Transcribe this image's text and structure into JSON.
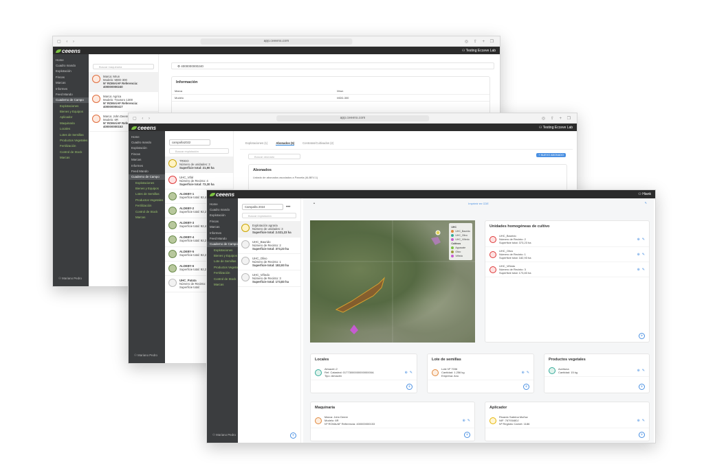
{
  "app": {
    "brand": "ceeens",
    "user1": "Testing Ecceve Lab",
    "user3": "Hiank"
  },
  "w1": {
    "url": "app.ceeens.com",
    "search_placeholder": "Buscar maquinaria",
    "sidebar": [
      "Home",
      "Cuadro mando",
      "Explotación",
      "Fincas",
      "Marcas",
      "Informes",
      "Feed Mando"
    ],
    "section": "Cuaderno de Campo",
    "subitems": [
      "Explotaciones",
      "Bienes y Equipos",
      "Aplicador",
      "Maquinaria",
      "Locales",
      "Lotes de Semillas",
      "Productos Vegetales",
      "Fertilización",
      "Control de Stock",
      "Marcas"
    ],
    "machine_ref": "4000000000240",
    "items": [
      {
        "l1": "Marca: Mrun",
        "l2": "Modelo: MDD-300",
        "l3": "Nº ROMA/AF Referencia: 400000000240"
      },
      {
        "l1": "Marca: Agrica",
        "l2": "Modelo: Tractoro 1300",
        "l3": "Nº ROMA/AF Referencia: 400000000417"
      },
      {
        "l1": "Marca: John Deere",
        "l2": "Modelo: 6R",
        "l3": "Nº ROMA/AF Referencia: 400000000153"
      }
    ],
    "info_title": "Información",
    "info_rows": [
      [
        "Marca",
        "Mrun"
      ],
      [
        "Modelo",
        "MDD-300"
      ]
    ],
    "user": "Mariano Pedro"
  },
  "w2": {
    "url": "app.ceeens.com",
    "campaign": "campaña2022",
    "search_placeholder": "Buscar explotación",
    "tabs": [
      "Explotaciones (1)",
      "Abonados (5)",
      "Contratos/Cultivados (2)"
    ],
    "new_btn": "+ NUEVO ABONADO",
    "search2": "Buscar abonado",
    "card_title": "Abonados",
    "card_sub": "Listado de abonados asociados a Parcela (ALBEV-1)",
    "cols": [
      "Nombre",
      "Inicio",
      "Final",
      "Acciones"
    ],
    "list": [
      {
        "t": "TRIGO",
        "a": "Número de unidades: 3",
        "b": "Superficie total: 21,90 ha"
      },
      {
        "t": "UHC_Vifal",
        "a": "Número de Recinto: 4",
        "b": "Superficie total: 73,30 ha"
      },
      {
        "t": "ALDEBY-1",
        "a": "Superficie total: 92,46",
        "b": ""
      },
      {
        "t": "ALDEBY-2",
        "a": "Superficie total: 92,27",
        "b": ""
      },
      {
        "t": "ALDEBY-3",
        "a": "Superficie total: 92,48",
        "b": ""
      },
      {
        "t": "ALDEBY-4",
        "a": "Superficie total: 92,27",
        "b": ""
      },
      {
        "t": "ALDEBY-5",
        "a": "Superficie total: 92,27",
        "b": ""
      },
      {
        "t": "ALDEBY-6",
        "a": "Superficie total: 92,27",
        "b": ""
      },
      {
        "t": "UHC_Patata",
        "a": "Número de Recinto: 2",
        "b": "Superficie total:"
      }
    ],
    "user": "Mariano Pedro"
  },
  "w3": {
    "campaign": "Campaña 2024",
    "search_placeholder": "Buscar explotación",
    "center_link": "Imprimir en CDE",
    "list": [
      {
        "t": "Explotación agraria",
        "a": "Número de unidades: 3",
        "b": "Superficie total: 2.021,23 ha"
      },
      {
        "t": "UHC_Baurido",
        "a": "Número de Recinto: 2",
        "b": "Superficie total: 373,23 ha"
      },
      {
        "t": "UHC_Olivo",
        "a": "Número de Recinto: 1",
        "b": "Superficie total: 182,93 ha"
      },
      {
        "t": "UHC_Viñedo",
        "a": "Número de Recinto: 3",
        "b": "Superficie total: 173,83 ha"
      }
    ],
    "map_legend": {
      "title": "UHC",
      "items": [
        "UHC_Baurido",
        "UHC_Olivo",
        "UHC_Viñedo"
      ],
      "title2": "Cultivos",
      "items2": [
        "Aguacate",
        "Olivo",
        "Viñedo"
      ]
    },
    "uhc_title": "Unidades homogéneas de cultivo",
    "uhc": [
      {
        "t": "UHC_Baurido",
        "a": "Número de Recinto: 2",
        "b": "Superficie total: 373,23 ha"
      },
      {
        "t": "UHC_Olivo",
        "a": "Número de Recinto: 1",
        "b": "Superficie total: 182,93 ha"
      },
      {
        "t": "UHC_Viñedo",
        "a": "Número de Recinto: 3",
        "b": "Superficie total: 173,83 ha"
      }
    ],
    "locales": {
      "title": "Locales",
      "a": "Almacén 2",
      "b": "Ref. Catastral: 0177300000000000000A",
      "c": "Tipo: Almacén"
    },
    "semillas": {
      "title": "Lote de semillas",
      "a": "Lote Nº 7036",
      "b": "Cantidad: 1.256 kg",
      "c": "Empresa: Anu"
    },
    "productos": {
      "title": "Productos vegetales",
      "a": "Aceituna",
      "b": "Cantidad: 15 kg"
    },
    "maquinaria": {
      "title": "Maquinaria",
      "a": "Marca: John Deere",
      "b": "Modelo: 6R",
      "c": "Nº ROMA/AF Referencia: 400000000153"
    },
    "aplicador": {
      "title": "Aplicador",
      "a": "Ricardo Sabrina Muñoz",
      "b": "NIF: 76793480J",
      "c": "Nº Registro Carnet: 1186"
    },
    "sidebar": [
      "Home",
      "Cuadro mando",
      "Explotación",
      "Fincas",
      "Marcas",
      "Informes",
      "Feed Mando"
    ],
    "section": "Cuaderno de Campo",
    "subitems": [
      "Explotaciones",
      "Bienes y Equipos",
      "Lote de Semillas",
      "Productos Vegetales",
      "Fertilización",
      "Control de Stock",
      "Marcas"
    ],
    "user": "Mariano Pedro"
  }
}
